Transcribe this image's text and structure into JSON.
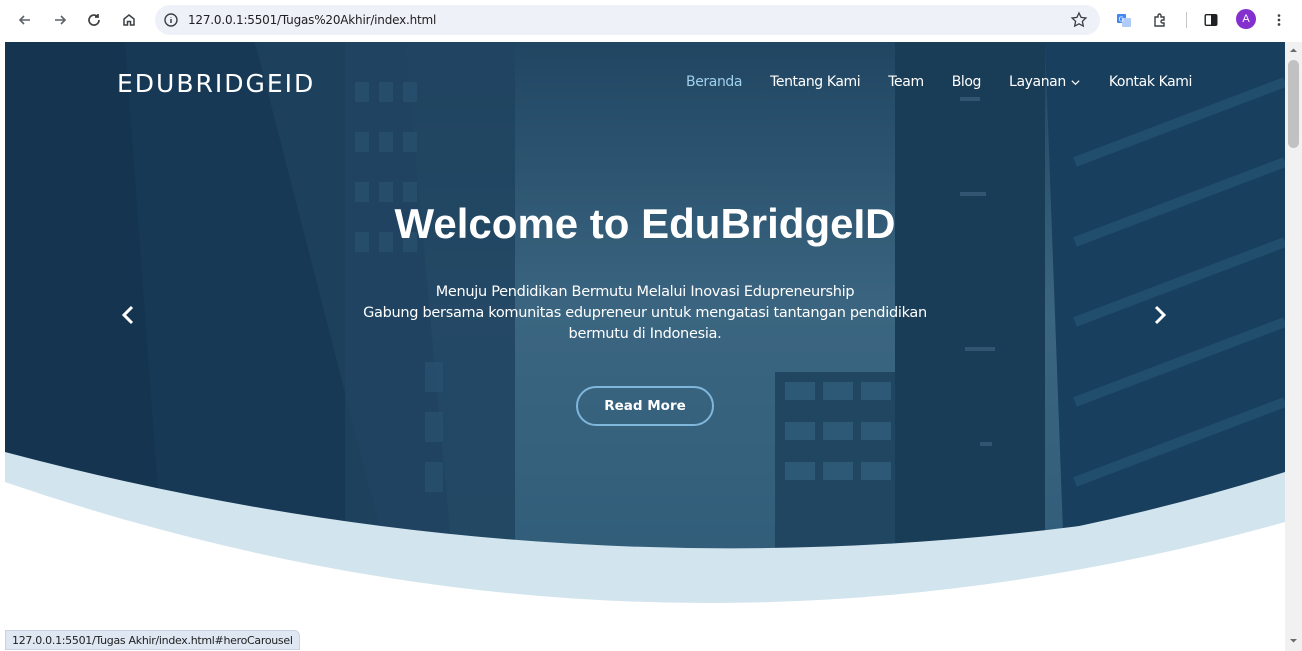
{
  "browser": {
    "url": "127.0.0.1:5501/Tugas%20Akhir/index.html",
    "profile_initial": "A",
    "status_url": "127.0.0.1:5501/Tugas Akhir/index.html#heroCarousel"
  },
  "site": {
    "brand": "EDUBRIDGEID",
    "nav": [
      {
        "label": "Beranda",
        "active": true
      },
      {
        "label": "Tentang Kami"
      },
      {
        "label": "Team"
      },
      {
        "label": "Blog"
      },
      {
        "label": "Layanan",
        "dropdown": true
      },
      {
        "label": "Kontak Kami"
      }
    ]
  },
  "hero": {
    "title": "Welcome to EduBridgeID",
    "subtitle_line1": "Menuju Pendidikan Bermutu Melalui Inovasi Edupreneurship",
    "subtitle_line2": "Gabung bersama komunitas edupreneur untuk mengatasi tantangan pendidikan",
    "subtitle_line3": "bermutu di Indonesia.",
    "button": "Read More"
  },
  "colors": {
    "accent": "#7fb7dc",
    "active_nav": "#9fd0ec",
    "curve": "#d2e4ee"
  },
  "icons": [
    "back-icon",
    "forward-icon",
    "reload-icon",
    "home-icon",
    "info-icon",
    "star-icon",
    "translate-icon",
    "extensions-icon",
    "side-panel-icon",
    "menu-icon",
    "chevron-left-icon",
    "chevron-right-icon",
    "chevron-down-icon"
  ]
}
